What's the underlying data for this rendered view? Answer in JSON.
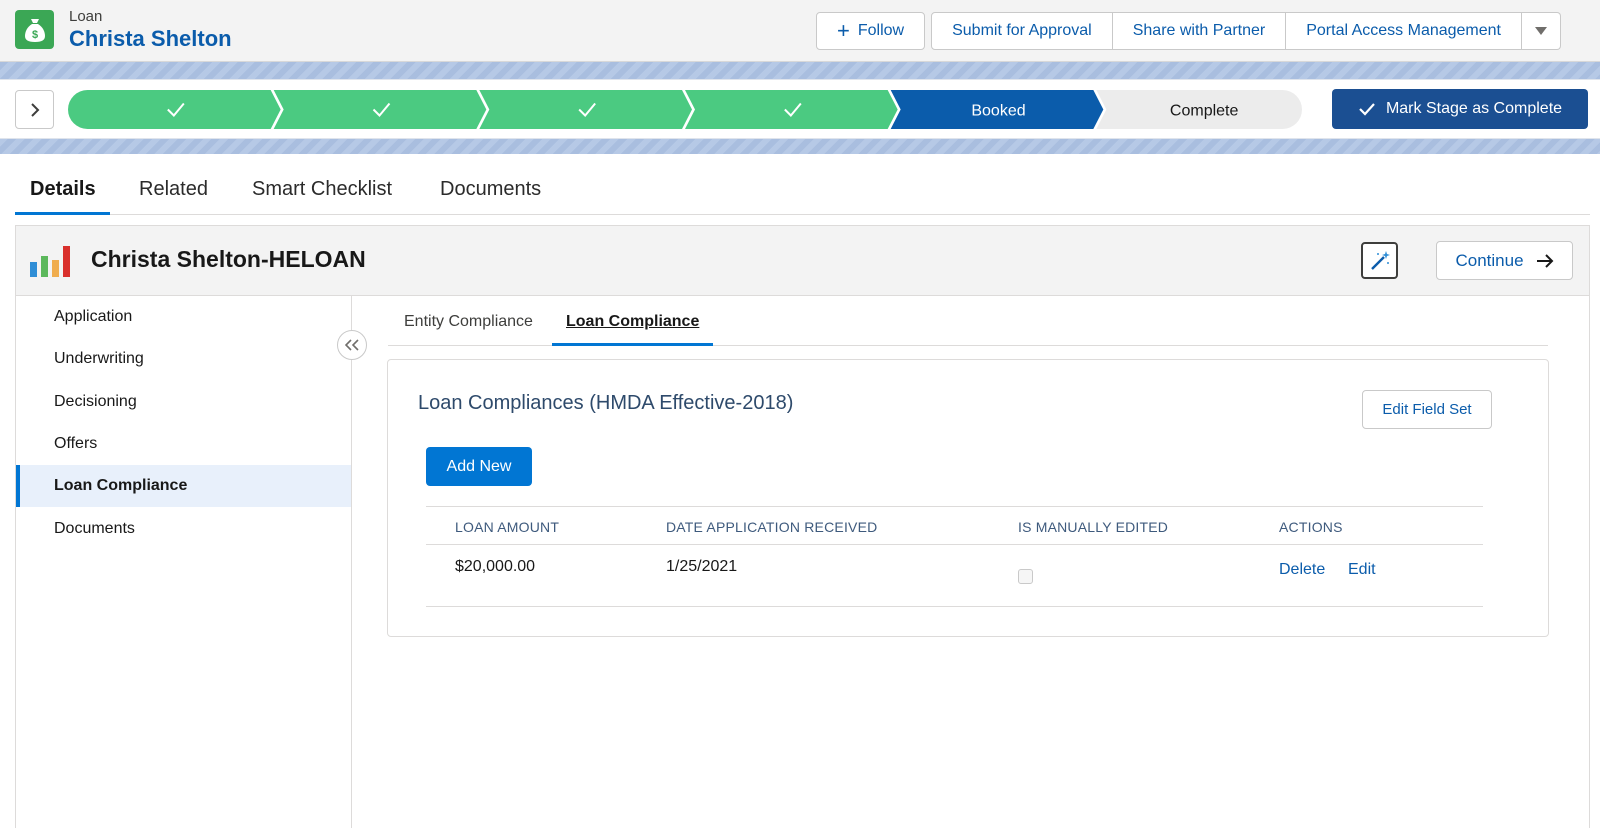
{
  "header": {
    "object_label": "Loan",
    "record_name": "Christa Shelton",
    "icon": "money-bag-icon",
    "buttons": {
      "follow": "Follow",
      "submit_for_approval": "Submit for Approval",
      "share_with_partner": "Share with Partner",
      "portal_access_management": "Portal Access Management"
    }
  },
  "path": {
    "stages": [
      {
        "label": "",
        "status": "complete"
      },
      {
        "label": "",
        "status": "complete"
      },
      {
        "label": "",
        "status": "complete"
      },
      {
        "label": "",
        "status": "complete"
      },
      {
        "label": "Booked",
        "status": "current"
      },
      {
        "label": "Complete",
        "status": "incomplete"
      }
    ],
    "mark_complete_label": "Mark Stage as Complete"
  },
  "tabs": [
    "Details",
    "Related",
    "Smart Checklist",
    "Documents"
  ],
  "card": {
    "title": "Christa Shelton-HELOAN",
    "continue_label": "Continue"
  },
  "sidenav": {
    "items": [
      "Application",
      "Underwriting",
      "Decisioning",
      "Offers",
      "Loan Compliance",
      "Documents"
    ],
    "active": "Loan Compliance"
  },
  "subtabs": [
    "Entity Compliance",
    "Loan Compliance"
  ],
  "compliance": {
    "title": "Loan Compliances (HMDA Effective-2018)",
    "edit_field_set_label": "Edit Field Set",
    "add_new_label": "Add New",
    "columns": [
      "LOAN AMOUNT",
      "DATE APPLICATION RECEIVED",
      "IS MANUALLY EDITED",
      "ACTIONS"
    ],
    "rows": [
      {
        "loan_amount": "$20,000.00",
        "date_received": "1/25/2021",
        "manually_edited": false,
        "actions": [
          "Delete",
          "Edit"
        ]
      }
    ]
  },
  "colors": {
    "brand_blue": "#0176d3",
    "link_blue": "#0b5cab",
    "path_complete": "#4bca81",
    "path_current": "#0b5cab",
    "path_incomplete": "#ececec",
    "mark_button": "#1b4f92"
  }
}
